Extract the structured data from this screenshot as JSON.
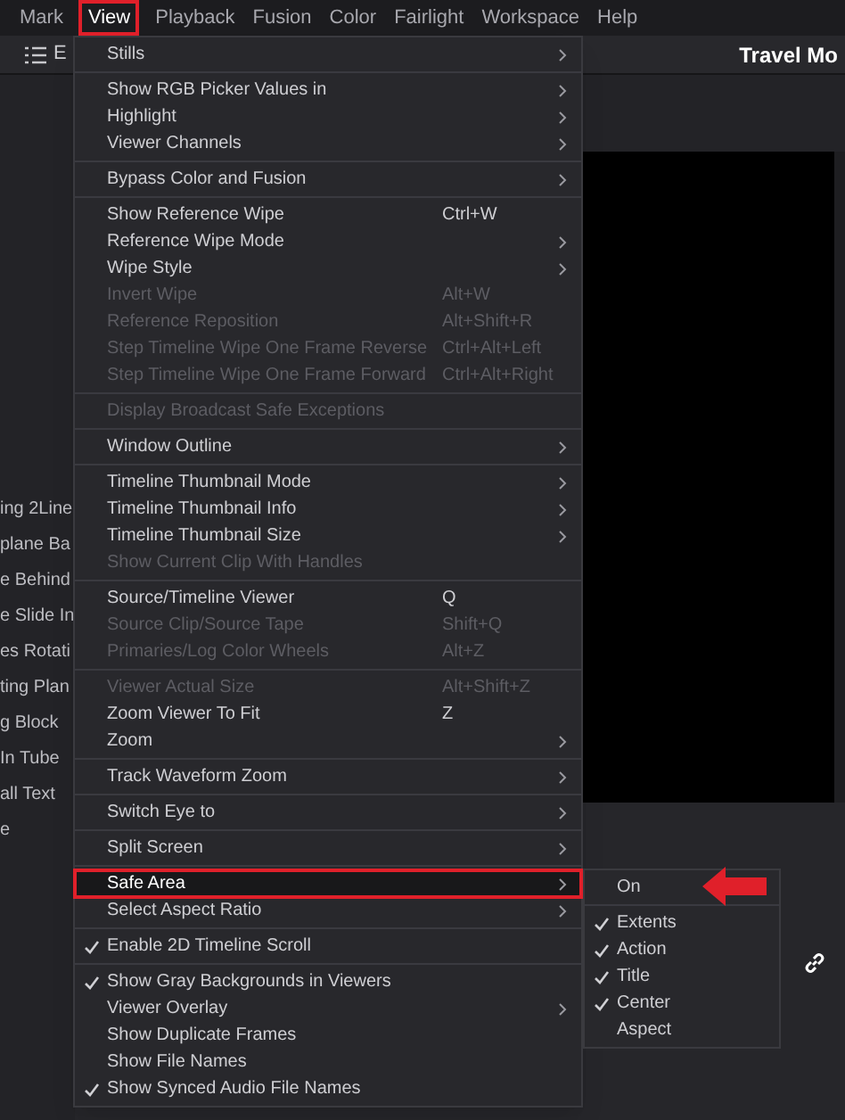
{
  "menubar": [
    {
      "label": "Mark",
      "selected": false
    },
    {
      "label": "View",
      "selected": true
    },
    {
      "label": "Playback",
      "selected": false
    },
    {
      "label": "Fusion",
      "selected": false
    },
    {
      "label": "Color",
      "selected": false
    },
    {
      "label": "Fairlight",
      "selected": false
    },
    {
      "label": "Workspace",
      "selected": false
    },
    {
      "label": "Help",
      "selected": false
    }
  ],
  "toolbar": {
    "edit_label": "E",
    "project_title": "Travel Mo"
  },
  "clip_list": [
    "ing 2Line",
    "plane Ba",
    "e Behind",
    "e Slide In",
    "es Rotati",
    "ting Plan",
    "g Block",
    "In Tube",
    "all Text",
    "e"
  ],
  "menu": {
    "groups": [
      [
        {
          "label": "Stills",
          "submenu": true,
          "disabled": false,
          "checked": false,
          "highlighted": false
        }
      ],
      [
        {
          "label": "Show RGB Picker Values in",
          "submenu": true,
          "disabled": false,
          "checked": false,
          "highlighted": false
        },
        {
          "label": "Highlight",
          "submenu": true,
          "disabled": false,
          "checked": false,
          "highlighted": false
        },
        {
          "label": "Viewer Channels",
          "submenu": true,
          "disabled": false,
          "checked": false,
          "highlighted": false
        }
      ],
      [
        {
          "label": "Bypass Color and Fusion",
          "submenu": true,
          "disabled": false,
          "checked": false,
          "highlighted": false
        }
      ],
      [
        {
          "label": "Show Reference Wipe",
          "shortcut": "Ctrl+W",
          "submenu": false,
          "disabled": false,
          "checked": false,
          "highlighted": false
        },
        {
          "label": "Reference Wipe Mode",
          "submenu": true,
          "disabled": false,
          "checked": false,
          "highlighted": false
        },
        {
          "label": "Wipe Style",
          "submenu": true,
          "disabled": false,
          "checked": false,
          "highlighted": false
        },
        {
          "label": "Invert Wipe",
          "shortcut": "Alt+W",
          "submenu": false,
          "disabled": true,
          "checked": false,
          "highlighted": false
        },
        {
          "label": "Reference Reposition",
          "shortcut": "Alt+Shift+R",
          "submenu": false,
          "disabled": true,
          "checked": false,
          "highlighted": false
        },
        {
          "label": "Step Timeline Wipe One Frame Reverse",
          "shortcut": "Ctrl+Alt+Left",
          "submenu": false,
          "disabled": true,
          "checked": false,
          "highlighted": false
        },
        {
          "label": "Step Timeline Wipe One Frame Forward",
          "shortcut": "Ctrl+Alt+Right",
          "submenu": false,
          "disabled": true,
          "checked": false,
          "highlighted": false
        }
      ],
      [
        {
          "label": "Display Broadcast Safe Exceptions",
          "submenu": false,
          "disabled": true,
          "checked": false,
          "highlighted": false
        }
      ],
      [
        {
          "label": "Window Outline",
          "submenu": true,
          "disabled": false,
          "checked": false,
          "highlighted": false
        }
      ],
      [
        {
          "label": "Timeline Thumbnail Mode",
          "submenu": true,
          "disabled": false,
          "checked": false,
          "highlighted": false
        },
        {
          "label": "Timeline Thumbnail Info",
          "submenu": true,
          "disabled": false,
          "checked": false,
          "highlighted": false
        },
        {
          "label": "Timeline Thumbnail Size",
          "submenu": true,
          "disabled": false,
          "checked": false,
          "highlighted": false
        },
        {
          "label": "Show Current Clip With Handles",
          "submenu": false,
          "disabled": true,
          "checked": false,
          "highlighted": false
        }
      ],
      [
        {
          "label": "Source/Timeline Viewer",
          "shortcut": "Q",
          "submenu": false,
          "disabled": false,
          "checked": false,
          "highlighted": false
        },
        {
          "label": "Source Clip/Source Tape",
          "shortcut": "Shift+Q",
          "submenu": false,
          "disabled": true,
          "checked": false,
          "highlighted": false
        },
        {
          "label": "Primaries/Log Color Wheels",
          "shortcut": "Alt+Z",
          "submenu": false,
          "disabled": true,
          "checked": false,
          "highlighted": false
        }
      ],
      [
        {
          "label": "Viewer Actual Size",
          "shortcut": "Alt+Shift+Z",
          "submenu": false,
          "disabled": true,
          "checked": false,
          "highlighted": false
        },
        {
          "label": "Zoom Viewer To Fit",
          "shortcut": "Z",
          "submenu": false,
          "disabled": false,
          "checked": false,
          "highlighted": false
        },
        {
          "label": "Zoom",
          "submenu": true,
          "disabled": false,
          "checked": false,
          "highlighted": false
        }
      ],
      [
        {
          "label": "Track Waveform Zoom",
          "submenu": true,
          "disabled": false,
          "checked": false,
          "highlighted": false
        }
      ],
      [
        {
          "label": "Switch Eye to",
          "submenu": true,
          "disabled": false,
          "checked": false,
          "highlighted": false
        }
      ],
      [
        {
          "label": "Split Screen",
          "submenu": true,
          "disabled": false,
          "checked": false,
          "highlighted": false
        }
      ],
      [
        {
          "label": "Safe Area",
          "submenu": true,
          "disabled": false,
          "checked": false,
          "highlighted": true
        },
        {
          "label": "Select Aspect Ratio",
          "submenu": true,
          "disabled": false,
          "checked": false,
          "highlighted": false
        }
      ],
      [
        {
          "label": "Enable 2D Timeline Scroll",
          "submenu": false,
          "disabled": false,
          "checked": true,
          "highlighted": false
        }
      ],
      [
        {
          "label": "Show Gray Backgrounds in Viewers",
          "submenu": false,
          "disabled": false,
          "checked": true,
          "highlighted": false
        },
        {
          "label": "Viewer Overlay",
          "submenu": true,
          "disabled": false,
          "checked": false,
          "highlighted": false
        },
        {
          "label": "Show Duplicate Frames",
          "submenu": false,
          "disabled": false,
          "checked": false,
          "highlighted": false
        },
        {
          "label": "Show File Names",
          "submenu": false,
          "disabled": false,
          "checked": false,
          "highlighted": false
        },
        {
          "label": "Show Synced Audio File Names",
          "submenu": false,
          "disabled": false,
          "checked": true,
          "highlighted": false
        }
      ]
    ]
  },
  "submenu": {
    "groups": [
      [
        {
          "label": "On",
          "checked": false,
          "pointer": true
        }
      ],
      [
        {
          "label": "Extents",
          "checked": true,
          "pointer": false
        },
        {
          "label": "Action",
          "checked": true,
          "pointer": false
        },
        {
          "label": "Title",
          "checked": true,
          "pointer": false
        },
        {
          "label": "Center",
          "checked": true,
          "pointer": false
        },
        {
          "label": "Aspect",
          "checked": false,
          "pointer": false
        }
      ]
    ]
  }
}
